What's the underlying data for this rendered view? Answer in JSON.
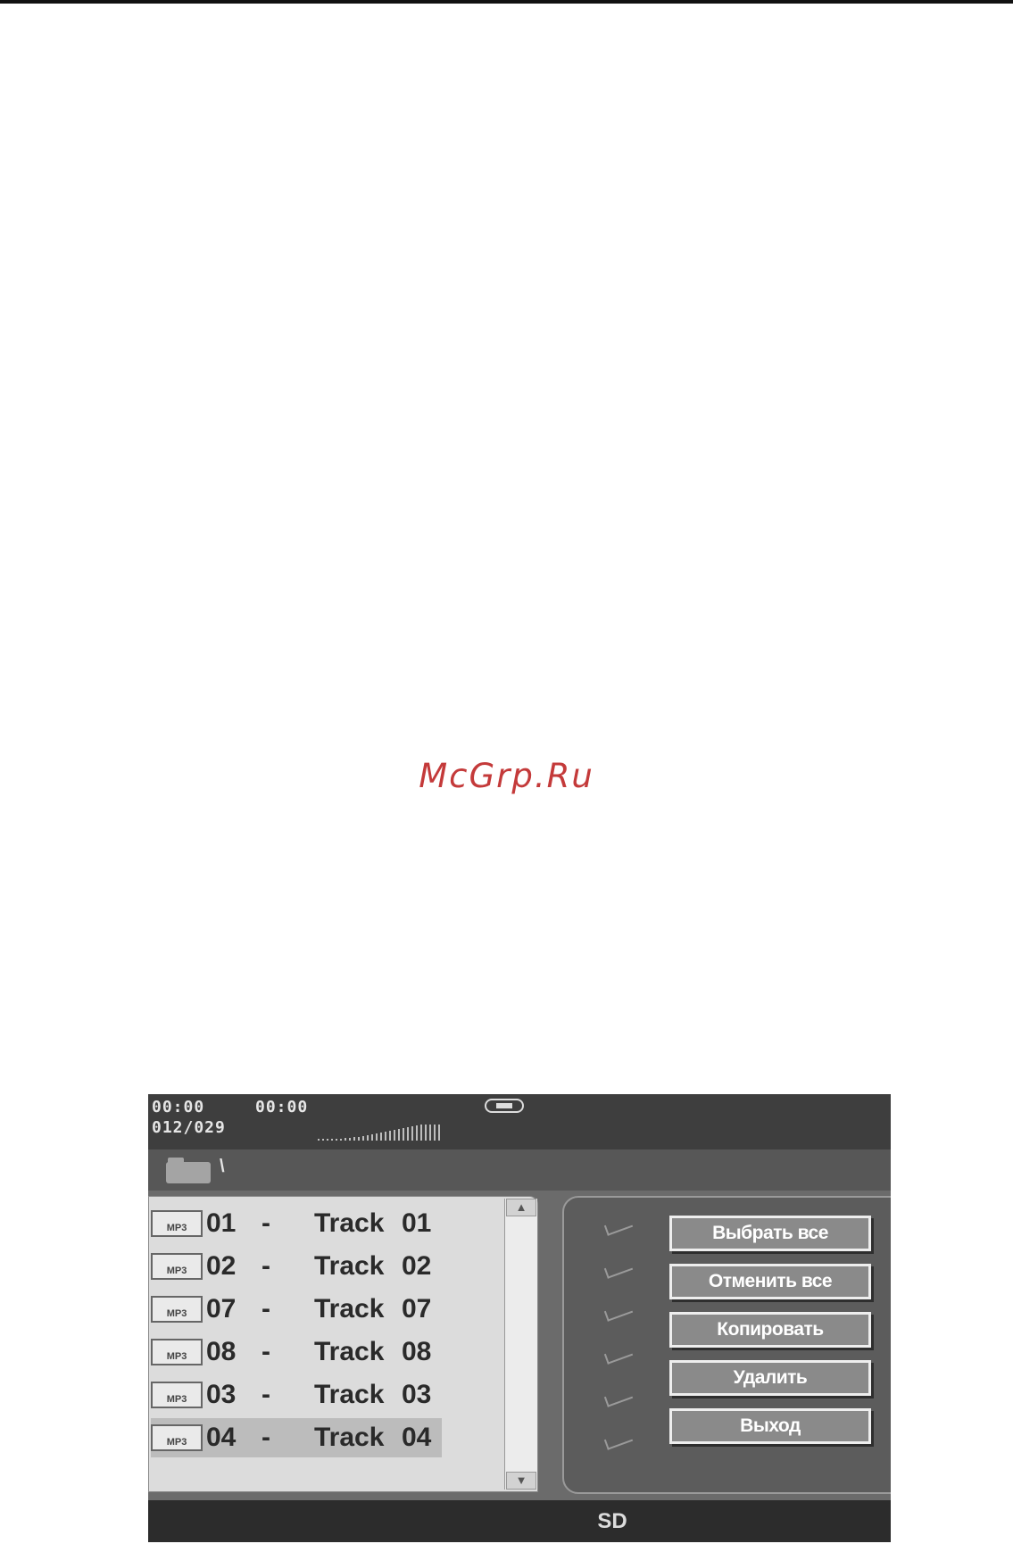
{
  "watermark": "McGrp.Ru",
  "player": {
    "elapsed_time": "00:00",
    "total_time": "00:00",
    "track_counter": "012/029",
    "path": "\\",
    "source": "SD"
  },
  "file_list": [
    {
      "icon_label": "MP3",
      "number": "01",
      "dash": "-",
      "title": "Track",
      "title_number": "01"
    },
    {
      "icon_label": "MP3",
      "number": "02",
      "dash": "-",
      "title": "Track",
      "title_number": "02"
    },
    {
      "icon_label": "MP3",
      "number": "07",
      "dash": "-",
      "title": "Track",
      "title_number": "07"
    },
    {
      "icon_label": "MP3",
      "number": "08",
      "dash": "-",
      "title": "Track",
      "title_number": "08"
    },
    {
      "icon_label": "MP3",
      "number": "03",
      "dash": "-",
      "title": "Track",
      "title_number": "03"
    },
    {
      "icon_label": "MP3",
      "number": "04",
      "dash": "-",
      "title": "Track",
      "title_number": "04"
    }
  ],
  "actions": {
    "select_all": "Выбрать все",
    "deselect_all": "Отменить все",
    "copy": "Копировать",
    "delete": "Удалить",
    "exit": "Выход"
  },
  "colors": {
    "watermark": "#c43a3a",
    "screen_background": "#6b6b6b",
    "list_background": "#dcdcdc",
    "button_background": "#8a8a8a"
  }
}
